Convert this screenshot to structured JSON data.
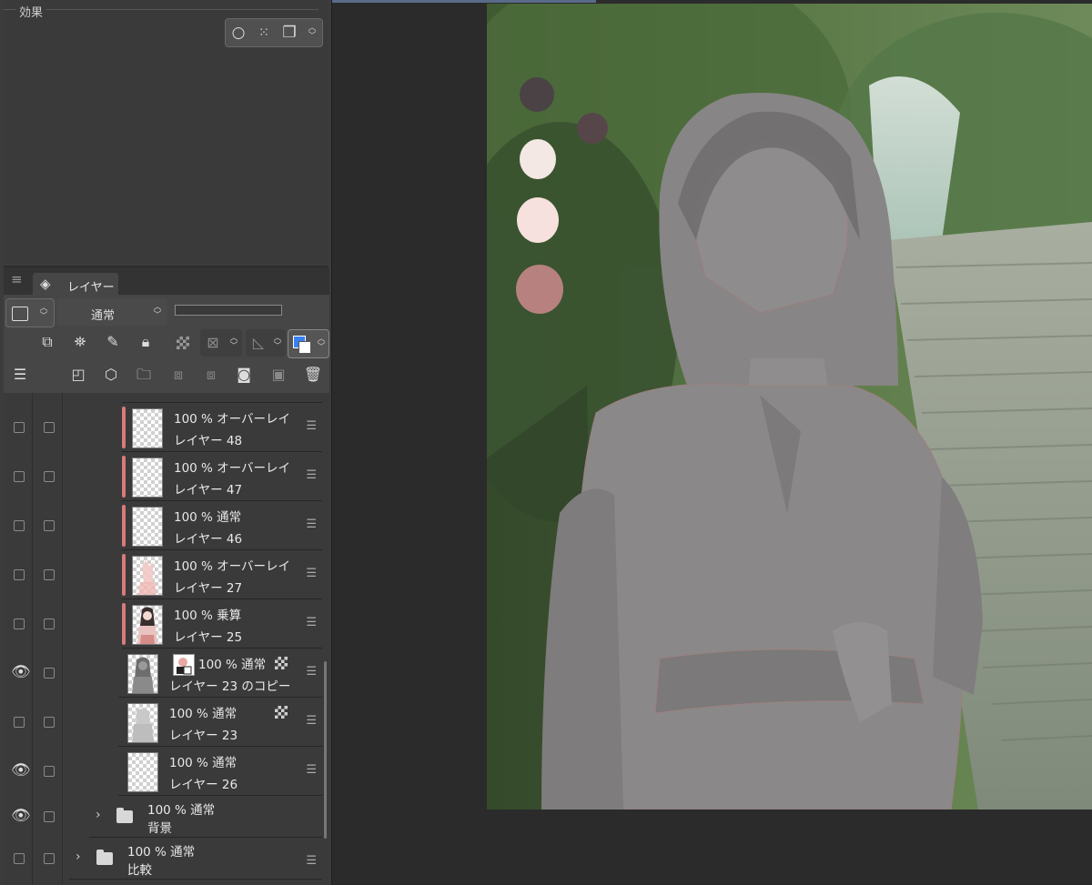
{
  "effect_panel": {
    "title": "効果"
  },
  "layer_panel": {
    "tab_label": "レイヤー",
    "blend_mode": "通常",
    "layers": [
      {
        "mode": "100 % オーバーレイ",
        "name": "レイヤー 48",
        "visible": false,
        "clipped": true
      },
      {
        "mode": "100 % オーバーレイ",
        "name": "レイヤー 47",
        "visible": false,
        "clipped": true
      },
      {
        "mode": "100 % 通常",
        "name": "レイヤー 46",
        "visible": false,
        "clipped": true
      },
      {
        "mode": "100 % オーバーレイ",
        "name": "レイヤー 27",
        "visible": false,
        "clipped": true
      },
      {
        "mode": "100 % 乗算",
        "name": "レイヤー 25",
        "visible": false,
        "clipped": true
      },
      {
        "mode": "100 % 通常",
        "name": "レイヤー 23 のコピー",
        "visible": true,
        "clipped": false
      },
      {
        "mode": "100 % 通常",
        "name": "レイヤー 23",
        "visible": false,
        "clipped": false
      },
      {
        "mode": "100 % 通常",
        "name": "レイヤー 26",
        "visible": true,
        "clipped": false
      }
    ],
    "folders": [
      {
        "mode": "100 % 通常",
        "name": "背景",
        "visible": true
      },
      {
        "mode": "100 % 通常",
        "name": "比較",
        "visible": false
      }
    ]
  },
  "palette_swatches": [
    "#4a4244",
    "#574649",
    "#f3e8e4",
    "#f6e1de",
    "#b7817f"
  ]
}
